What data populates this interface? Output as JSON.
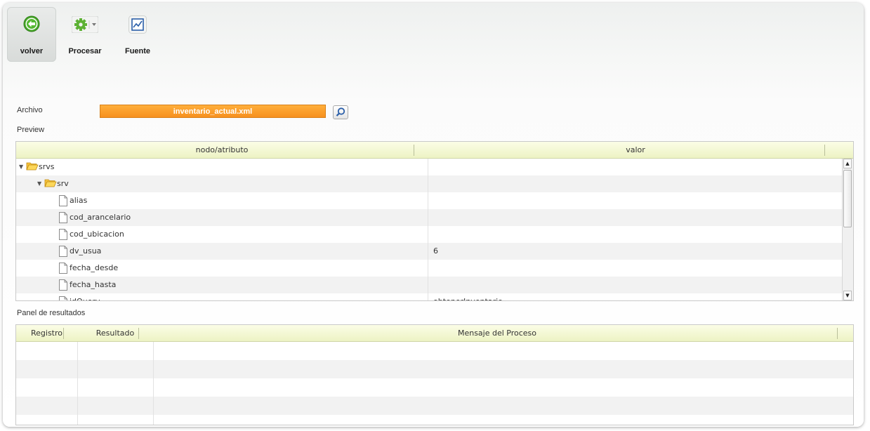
{
  "toolbar": {
    "volver_label": "volver",
    "procesar_label": "Procesar",
    "fuente_label": "Fuente"
  },
  "archivo": {
    "label": "Archivo",
    "value": "inventario_actual.xml"
  },
  "preview_label": "Preview",
  "tree_grid": {
    "headers": [
      "nodo/atributo",
      "valor"
    ],
    "rows": [
      {
        "name": "srvs",
        "type": "folder",
        "level": 0,
        "expanded": true,
        "value": ""
      },
      {
        "name": "srv",
        "type": "folder",
        "level": 1,
        "expanded": true,
        "value": ""
      },
      {
        "name": "alias",
        "type": "file",
        "level": 2,
        "value": ""
      },
      {
        "name": "cod_arancelario",
        "type": "file",
        "level": 2,
        "value": ""
      },
      {
        "name": "cod_ubicacion",
        "type": "file",
        "level": 2,
        "value": ""
      },
      {
        "name": "dv_usua",
        "type": "file",
        "level": 2,
        "value": "6"
      },
      {
        "name": "fecha_desde",
        "type": "file",
        "level": 2,
        "value": ""
      },
      {
        "name": "fecha_hasta",
        "type": "file",
        "level": 2,
        "value": ""
      },
      {
        "name": "idQuery",
        "type": "file",
        "level": 2,
        "value": "obtenerInventario"
      }
    ]
  },
  "results": {
    "label": "Panel de resultados",
    "headers": [
      "Registro",
      "Resultado",
      "Mensaje del Proceso"
    ],
    "empty_rows": 5
  },
  "colors": {
    "accent_orange": "#f7901e",
    "header_green": "#edf3c4",
    "icon_green": "#4caf2c",
    "icon_blue": "#2a5ea8"
  }
}
